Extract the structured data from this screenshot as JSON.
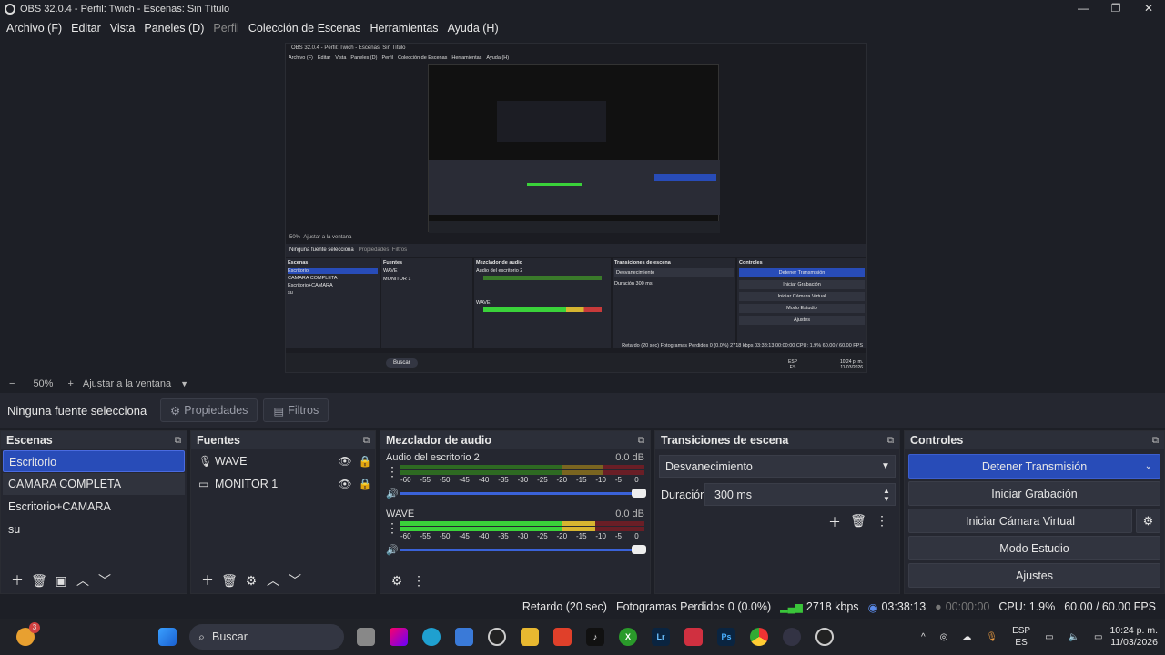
{
  "window": {
    "title": "OBS 32.0.4 - Perfil: Twich - Escenas: Sin Título",
    "minimize": "—",
    "maximize": "❐",
    "close": "✕"
  },
  "menu": [
    "Archivo (F)",
    "Editar",
    "Vista",
    "Paneles (D)",
    "Perfil",
    "Colección de Escenas",
    "Herramientas",
    "Ayuda (H)"
  ],
  "zoom": {
    "minus": "−",
    "value": "50%",
    "plus": "+",
    "fit": "Ajustar a la ventana",
    "arrow": "▼"
  },
  "source_bar": {
    "no_source": "Ninguna fuente selecciona",
    "properties": "Propiedades",
    "filters": "Filtros"
  },
  "scenes": {
    "title": "Escenas",
    "items": [
      "Escritorio",
      "CAMARA COMPLETA",
      "Escritorio+CAMARA",
      "su"
    ]
  },
  "sources": {
    "title": "Fuentes",
    "items": [
      {
        "icon": "microphone-icon",
        "name": "WAVE"
      },
      {
        "icon": "monitor-icon",
        "name": "MONITOR 1"
      }
    ]
  },
  "mixer": {
    "title": "Mezclador de audio",
    "ticks": [
      "-60",
      "-55",
      "-50",
      "-45",
      "-40",
      "-35",
      "-30",
      "-25",
      "-20",
      "-15",
      "-10",
      "-5",
      "0"
    ],
    "channels": [
      {
        "name": "Audio del escritorio 2",
        "db": "0.0 dB",
        "level": 0
      },
      {
        "name": "WAVE",
        "db": "0.0 dB",
        "level": 0.75
      }
    ]
  },
  "transitions": {
    "title": "Transiciones de escena",
    "selected": "Desvanecimiento",
    "duration_label": "Duración",
    "duration": "300 ms"
  },
  "controls": {
    "title": "Controles",
    "stop_stream": "Detener Transmisión",
    "start_rec": "Iniciar Grabación",
    "virtual_cam": "Iniciar Cámara Virtual",
    "studio": "Modo Estudio",
    "settings": "Ajustes"
  },
  "status": {
    "delay": "Retardo (20 sec)",
    "dropped": "Fotogramas Perdidos 0 (0.0%)",
    "kbps": "2718 kbps",
    "stream_time": "03:38:13",
    "rec_time": "00:00:00",
    "cpu": "CPU: 1.9%",
    "fps": "60.00 / 60.00 FPS"
  },
  "taskbar": {
    "search": "Buscar",
    "lang": "ESP",
    "region": "ES",
    "time": "10:24 p. m.",
    "date": "11/03/2026",
    "badge": "3"
  },
  "preview": {
    "title": "OBS 32.0.4 - Perfil: Twich - Escenas: Sin Título",
    "zoom": "50%",
    "fit": "Ajustar a la ventana",
    "no_source": "Ninguna fuente selecciona",
    "properties": "Propiedades",
    "filters": "Filtros",
    "delay": "Retardo (20 sec)",
    "dropped": "Fotogramas Perdidos 0 (0.0%)",
    "kbps": "2718 kbps",
    "stream_time": "03:38:13",
    "rec_time": "00:00:00",
    "cpu": "CPU: 1.9%",
    "fps": "60.00 / 60.00 FPS",
    "search": "Buscar",
    "clock": "10:24 p. m.",
    "date": "11/03/2026",
    "lang": "ESP",
    "region": "ES"
  },
  "colors": {
    "accent": "#284cb8",
    "bg": "#1d1f26",
    "panel": "#252730",
    "meter_green": "#3ad23a",
    "meter_yellow": "#d6b530",
    "meter_red": "#c83a3a"
  }
}
